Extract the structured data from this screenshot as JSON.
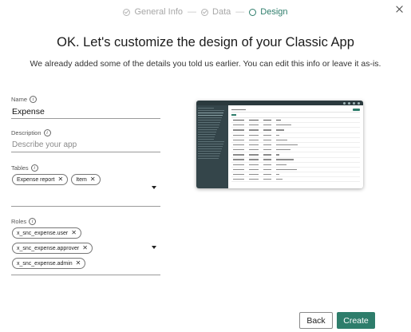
{
  "stepper": {
    "steps": [
      {
        "label": "General Info",
        "state": "done"
      },
      {
        "label": "Data",
        "state": "done"
      },
      {
        "label": "Design",
        "state": "active"
      }
    ],
    "separator": "—"
  },
  "header": {
    "title": "OK. Let's customize the design of your Classic App",
    "subtitle": "We already added some of the details you told us earlier. You can edit this info or leave it as-is."
  },
  "form": {
    "name": {
      "label": "Name",
      "value": "Expense",
      "info_icon": "info-icon"
    },
    "description": {
      "label": "Description",
      "placeholder": "Describe your app",
      "value": ""
    },
    "tables": {
      "label": "Tables",
      "chips": [
        "Expense report",
        "Item"
      ]
    },
    "roles": {
      "label": "Roles",
      "chips": [
        "x_snc_expense.user",
        "x_snc_expense.approver",
        "x_snc_expense.admin"
      ]
    }
  },
  "icons": {
    "info": "i",
    "remove": "✕",
    "close": "close-icon"
  },
  "footer": {
    "back_label": "Back",
    "create_label": "Create"
  },
  "colors": {
    "accent": "#2e7d6b",
    "preview_sidebar": "#34454a",
    "preview_topbar": "#2b3a3e"
  }
}
